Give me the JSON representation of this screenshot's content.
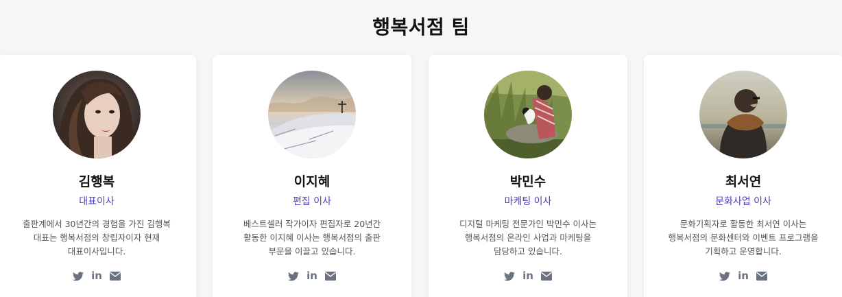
{
  "section": {
    "title": "행복서점 팀"
  },
  "accent_color": "#4b3fc8",
  "icon_color": "#6b7280",
  "team": [
    {
      "name": "김행복",
      "role": "대표이사",
      "bio": "출판계에서 30년간의 경험을 가진 김행복 대표는 행복서점의 창립자이자 현재 대표이사입니다.",
      "avatar": "woman-portrait-photo",
      "socials": [
        "twitter-icon",
        "linkedin-icon",
        "email-icon"
      ]
    },
    {
      "name": "이지혜",
      "role": "편집 이사",
      "bio": "베스트셀러 작가이자 편집자로 20년간 활동한 이지혜 이사는 행복서점의 출판 부문을 이끌고 있습니다.",
      "avatar": "snowy-hill-cross-photo",
      "socials": [
        "twitter-icon",
        "linkedin-icon",
        "email-icon"
      ]
    },
    {
      "name": "박민수",
      "role": "마케팅 이사",
      "bio": "디지털 마케팅 전문가인 박민수 이사는 행복서점의 온라인 사업과 마케팅을 담당하고 있습니다.",
      "avatar": "man-reading-in-grass-photo",
      "socials": [
        "twitter-icon",
        "linkedin-icon",
        "email-icon"
      ]
    },
    {
      "name": "최서연",
      "role": "문화사업 이사",
      "bio": "문화기획자로 활동한 최서연 이사는 행복서점의 문화센터와 이벤트 프로그램을 기획하고 운영합니다.",
      "avatar": "person-with-scarf-photo",
      "socials": [
        "twitter-icon",
        "linkedin-icon",
        "email-icon"
      ]
    }
  ]
}
